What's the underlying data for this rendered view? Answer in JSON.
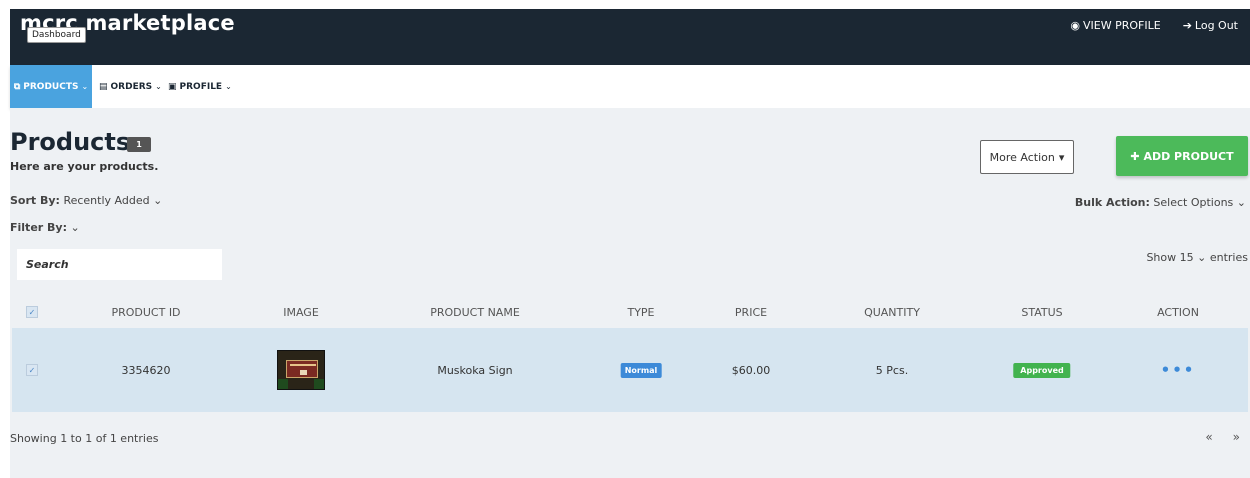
{
  "brand": {
    "title": "mcrc marketplace",
    "tooltip": "Dashboard"
  },
  "topbar": {
    "view_profile": "VIEW PROFILE",
    "logout": "Log Out"
  },
  "nav": {
    "products": "PRODUCTS",
    "orders": "ORDERS",
    "profile": "PROFILE"
  },
  "page": {
    "title": "Products",
    "count": "1",
    "subtitle": "Here are your products."
  },
  "actions": {
    "more_action": "More Action",
    "add_product": "ADD PRODUCT"
  },
  "filters": {
    "sort_label": "Sort By:",
    "sort_value": "Recently Added",
    "filter_label": "Filter By:",
    "bulk_label": "Bulk Action:",
    "bulk_value": "Select Options",
    "search_placeholder": "Search",
    "show_prefix": "Show",
    "show_value": "15",
    "show_suffix": "entries"
  },
  "table": {
    "columns": [
      "PRODUCT ID",
      "IMAGE",
      "PRODUCT NAME",
      "TYPE",
      "PRICE",
      "QUANTITY",
      "STATUS",
      "ACTION"
    ],
    "rows": [
      {
        "selected": true,
        "product_id": "3354620",
        "image": "muskoka-sign-thumbnail",
        "product_name": "Muskoka Sign",
        "type": "Normal",
        "price": "$60.00",
        "quantity": "5 Pcs.",
        "status": "Approved",
        "action": "•••"
      }
    ]
  },
  "footer": {
    "showing": "Showing 1 to 1 of 1 entries",
    "prev": "«",
    "next": "»"
  },
  "colors": {
    "topbar": "#1b2733",
    "nav_active": "#4aa3df",
    "add_button": "#4cba5a",
    "badge_normal": "#3d8ad8",
    "badge_approved": "#42b34f",
    "row_selected": "#d6e5f0",
    "content_bg": "#eef1f4"
  }
}
